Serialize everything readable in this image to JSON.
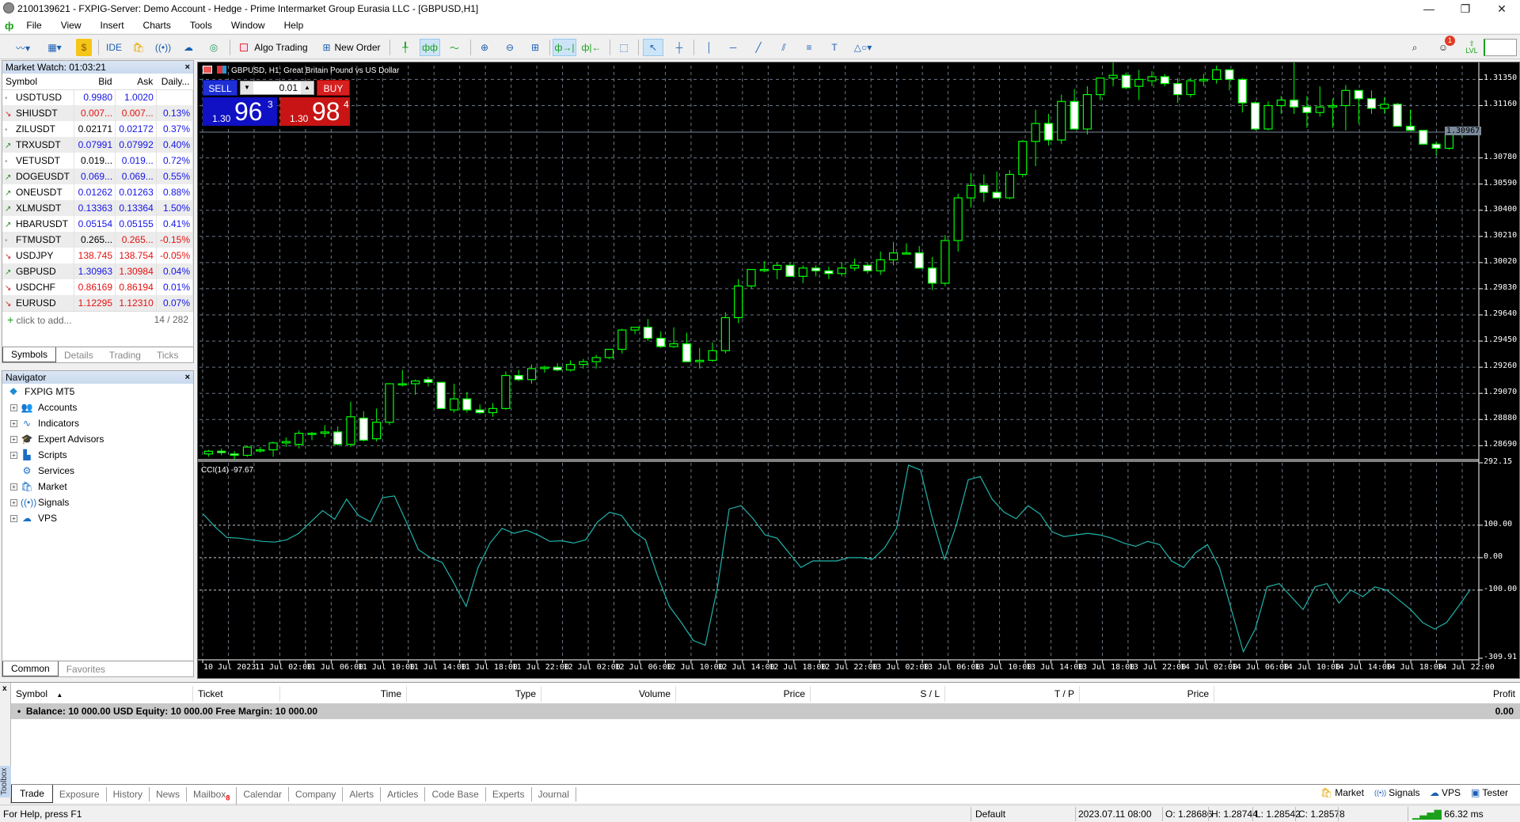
{
  "window": {
    "title": "2100139621 - FXPIG-Server: Demo Account - Hedge - Prime Intermarket Group Eurasia LLC - [GBPUSD,H1]"
  },
  "menu": [
    "File",
    "View",
    "Insert",
    "Charts",
    "Tools",
    "Window",
    "Help"
  ],
  "toolbar": {
    "ide_label": "IDE",
    "algo_trading_label": "Algo Trading",
    "new_order_label": "New Order",
    "notification_count": "1",
    "lvl_label": "LVL"
  },
  "market_watch": {
    "title": "Market Watch: 01:03:21",
    "columns": [
      "Symbol",
      "Bid",
      "Ask",
      "Daily..."
    ],
    "rows": [
      {
        "trend": "flat",
        "symbol": "USDTUSD",
        "bid": "0.9980",
        "bid_color": "blue",
        "ask": "1.0020",
        "ask_color": "blue",
        "daily": ""
      },
      {
        "trend": "down",
        "symbol": "SHIUSDT",
        "bid": "0.007...",
        "bid_color": "red",
        "ask": "0.007...",
        "ask_color": "red",
        "daily": "0.13%"
      },
      {
        "trend": "flat",
        "symbol": "ZILUSDT",
        "bid": "0.02171",
        "bid_color": "black",
        "ask": "0.02172",
        "ask_color": "blue",
        "daily": "0.37%"
      },
      {
        "trend": "up",
        "symbol": "TRXUSDT",
        "bid": "0.07991",
        "bid_color": "blue",
        "ask": "0.07992",
        "ask_color": "blue",
        "daily": "0.40%"
      },
      {
        "trend": "flat",
        "symbol": "VETUSDT",
        "bid": "0.019...",
        "bid_color": "black",
        "ask": "0.019...",
        "ask_color": "blue",
        "daily": "0.72%"
      },
      {
        "trend": "up",
        "symbol": "DOGEUSDT",
        "bid": "0.069...",
        "bid_color": "blue",
        "ask": "0.069...",
        "ask_color": "blue",
        "daily": "0.55%"
      },
      {
        "trend": "up",
        "symbol": "ONEUSDT",
        "bid": "0.01262",
        "bid_color": "blue",
        "ask": "0.01263",
        "ask_color": "blue",
        "daily": "0.88%"
      },
      {
        "trend": "up",
        "symbol": "XLMUSDT",
        "bid": "0.13363",
        "bid_color": "blue",
        "ask": "0.13364",
        "ask_color": "blue",
        "daily": "1.50%"
      },
      {
        "trend": "up",
        "symbol": "HBARUSDT",
        "bid": "0.05154",
        "bid_color": "blue",
        "ask": "0.05155",
        "ask_color": "blue",
        "daily": "0.41%"
      },
      {
        "trend": "flat",
        "symbol": "FTMUSDT",
        "bid": "0.265...",
        "bid_color": "black",
        "ask": "0.265...",
        "ask_color": "red",
        "daily": "-0.15%"
      },
      {
        "trend": "down",
        "symbol": "USDJPY",
        "bid": "138.745",
        "bid_color": "red",
        "ask": "138.754",
        "ask_color": "red",
        "daily": "-0.05%"
      },
      {
        "trend": "up",
        "symbol": "GBPUSD",
        "bid": "1.30963",
        "bid_color": "blue",
        "ask": "1.30984",
        "ask_color": "red",
        "daily": "0.04%"
      },
      {
        "trend": "down",
        "symbol": "USDCHF",
        "bid": "0.86169",
        "bid_color": "red",
        "ask": "0.86194",
        "ask_color": "red",
        "daily": "0.01%"
      },
      {
        "trend": "down",
        "symbol": "EURUSD",
        "bid": "1.12295",
        "bid_color": "red",
        "ask": "1.12310",
        "ask_color": "red",
        "daily": "0.07%"
      }
    ],
    "add_label": "click to add...",
    "count": "14 / 282",
    "tabs": [
      "Symbols",
      "Details",
      "Trading",
      "Ticks"
    ]
  },
  "navigator": {
    "title": "Navigator",
    "root": "FXPIG MT5",
    "items": [
      {
        "label": "Accounts",
        "icon": "accounts-icon",
        "glyph": "👥",
        "expand": true
      },
      {
        "label": "Indicators",
        "icon": "indicators-icon",
        "glyph": "∿",
        "expand": true
      },
      {
        "label": "Expert Advisors",
        "icon": "expert-advisors-icon",
        "glyph": "🎓",
        "expand": true
      },
      {
        "label": "Scripts",
        "icon": "scripts-icon",
        "glyph": "▙",
        "expand": true
      },
      {
        "label": "Services",
        "icon": "services-icon",
        "glyph": "⚙",
        "expand": false
      },
      {
        "label": "Market",
        "icon": "market-icon",
        "glyph": "🛍",
        "expand": true
      },
      {
        "label": "Signals",
        "icon": "signals-icon",
        "glyph": "((•))",
        "expand": true
      },
      {
        "label": "VPS",
        "icon": "vps-icon",
        "glyph": "☁",
        "expand": true
      }
    ],
    "tabs": [
      "Common",
      "Favorites"
    ]
  },
  "chart": {
    "label": "GBPUSD, H1:  Great Britain Pound vs US Dollar",
    "sell_label": "SELL",
    "buy_label": "BUY",
    "volume": "0.01",
    "sell_price": {
      "prefix": "1.30",
      "big": "96",
      "small": "3"
    },
    "buy_price": {
      "prefix": "1.30",
      "big": "98",
      "small": "4"
    },
    "current_price": "1.30967",
    "indicator_label": "CCI(14) -97.67"
  },
  "chart_data": [
    {
      "type": "candlestick",
      "title": "GBPUSD, H1",
      "ylim": [
        1.286,
        1.3145
      ],
      "y_ticks": [
        "1.31350",
        "1.31160",
        "1.30780",
        "1.30590",
        "1.30400",
        "1.30210",
        "1.30020",
        "1.29830",
        "1.29640",
        "1.29450",
        "1.29260",
        "1.29070",
        "1.28880",
        "1.28690"
      ],
      "y_tick_values": [
        1.3135,
        1.3116,
        1.3078,
        1.3059,
        1.304,
        1.3021,
        1.3002,
        1.2983,
        1.2964,
        1.2945,
        1.2926,
        1.2907,
        1.2888,
        1.2869
      ],
      "x_ticks": [
        "10 Jul 2023",
        "11 Jul 02:00",
        "11 Jul 06:00",
        "11 Jul 10:00",
        "11 Jul 14:00",
        "11 Jul 18:00",
        "11 Jul 22:00",
        "12 Jul 02:00",
        "12 Jul 06:00",
        "12 Jul 10:00",
        "12 Jul 14:00",
        "12 Jul 18:00",
        "12 Jul 22:00",
        "13 Jul 02:00",
        "13 Jul 06:00",
        "13 Jul 10:00",
        "13 Jul 14:00",
        "13 Jul 18:00",
        "13 Jul 22:00",
        "14 Jul 02:00",
        "14 Jul 06:00",
        "14 Jul 10:00",
        "14 Jul 14:00",
        "14 Jul 18:00",
        "14 Jul 22:00"
      ],
      "current_price": 1.30967,
      "ohlc": [
        [
          1.2863,
          1.2866,
          1.2861,
          1.2865
        ],
        [
          1.2865,
          1.2867,
          1.2862,
          1.2864
        ],
        [
          1.2863,
          1.2865,
          1.2859,
          1.2862
        ],
        [
          1.2862,
          1.2869,
          1.2861,
          1.2868
        ],
        [
          1.2866,
          1.2868,
          1.2864,
          1.2866
        ],
        [
          1.2866,
          1.2872,
          1.2861,
          1.2871
        ],
        [
          1.2871,
          1.2875,
          1.2868,
          1.2872
        ],
        [
          1.287,
          1.288,
          1.2867,
          1.2878
        ],
        [
          1.2878,
          1.2879,
          1.2873,
          1.2878
        ],
        [
          1.2878,
          1.2884,
          1.2875,
          1.2879
        ],
        [
          1.2879,
          1.2883,
          1.2869,
          1.287
        ],
        [
          1.287,
          1.2901,
          1.2868,
          1.289
        ],
        [
          1.2889,
          1.2894,
          1.2872,
          1.2873
        ],
        [
          1.2874,
          1.2896,
          1.2872,
          1.2886
        ],
        [
          1.2886,
          1.2914,
          1.2884,
          1.2914
        ],
        [
          1.2914,
          1.2924,
          1.2912,
          1.2914
        ],
        [
          1.2914,
          1.2917,
          1.2906,
          1.2916
        ],
        [
          1.2917,
          1.2919,
          1.2912,
          1.2915
        ],
        [
          1.2915,
          1.2915,
          1.2899,
          1.2896
        ],
        [
          1.2895,
          1.2914,
          1.2893,
          1.2903
        ],
        [
          1.2903,
          1.2908,
          1.2893,
          1.2895
        ],
        [
          1.2895,
          1.2899,
          1.2892,
          1.2893
        ],
        [
          1.2893,
          1.29,
          1.289,
          1.2896
        ],
        [
          1.2896,
          1.2923,
          1.2895,
          1.292
        ],
        [
          1.292,
          1.2924,
          1.2916,
          1.2917
        ],
        [
          1.2917,
          1.2928,
          1.2914,
          1.2925
        ],
        [
          1.2925,
          1.2927,
          1.2922,
          1.2926
        ],
        [
          1.2926,
          1.2929,
          1.2923,
          1.2924
        ],
        [
          1.2924,
          1.2931,
          1.2923,
          1.2928
        ],
        [
          1.2928,
          1.2932,
          1.2925,
          1.293
        ],
        [
          1.293,
          1.2935,
          1.2925,
          1.2933
        ],
        [
          1.2933,
          1.2939,
          1.2932,
          1.2939
        ],
        [
          1.2939,
          1.2954,
          1.2936,
          1.2953
        ],
        [
          1.2953,
          1.2955,
          1.295,
          1.2955
        ],
        [
          1.2955,
          1.2961,
          1.2945,
          1.2947
        ],
        [
          1.2947,
          1.2952,
          1.294,
          1.2941
        ],
        [
          1.2941,
          1.2955,
          1.294,
          1.2943
        ],
        [
          1.2943,
          1.2951,
          1.2937,
          1.293
        ],
        [
          1.293,
          1.294,
          1.2925,
          1.2931
        ],
        [
          1.2931,
          1.2944,
          1.293,
          1.2938
        ],
        [
          1.2938,
          1.2966,
          1.2936,
          1.2962
        ],
        [
          1.2962,
          1.299,
          1.2958,
          1.2985
        ],
        [
          1.2985,
          1.2997,
          1.2983,
          1.2997
        ],
        [
          1.2997,
          1.3003,
          1.2995,
          1.2997
        ],
        [
          1.2997,
          1.3002,
          1.299,
          1.3
        ],
        [
          1.3,
          1.3002,
          1.2995,
          1.2992
        ],
        [
          1.2992,
          1.3,
          1.2987,
          1.2998
        ],
        [
          1.2998,
          1.3,
          1.2992,
          1.2996
        ],
        [
          1.2996,
          1.2999,
          1.299,
          1.2994
        ],
        [
          1.2994,
          1.3002,
          1.2992,
          1.2998
        ],
        [
          1.2998,
          1.3005,
          1.2996,
          1.3
        ],
        [
          1.3,
          1.3002,
          1.2994,
          1.2996
        ],
        [
          1.2996,
          1.301,
          1.2993,
          1.3004
        ],
        [
          1.3004,
          1.3017,
          1.3,
          1.3009
        ],
        [
          1.3009,
          1.3016,
          1.3008,
          1.3009
        ],
        [
          1.3009,
          1.3014,
          1.2999,
          1.2998
        ],
        [
          1.2998,
          1.3006,
          1.2982,
          1.2987
        ],
        [
          1.2987,
          1.3022,
          1.2985,
          1.3018
        ],
        [
          1.3018,
          1.3052,
          1.301,
          1.3049
        ],
        [
          1.3049,
          1.3067,
          1.3042,
          1.3058
        ],
        [
          1.3058,
          1.3066,
          1.3046,
          1.3053
        ],
        [
          1.3053,
          1.3068,
          1.305,
          1.3049
        ],
        [
          1.3049,
          1.3069,
          1.3048,
          1.3066
        ],
        [
          1.3066,
          1.3091,
          1.3064,
          1.309
        ],
        [
          1.309,
          1.3113,
          1.3072,
          1.3103
        ],
        [
          1.3103,
          1.311,
          1.3087,
          1.3091
        ],
        [
          1.3091,
          1.3124,
          1.3088,
          1.3119
        ],
        [
          1.3119,
          1.3128,
          1.3107,
          1.3099
        ],
        [
          1.3099,
          1.313,
          1.3095,
          1.3124
        ],
        [
          1.3124,
          1.3135,
          1.312,
          1.3136
        ],
        [
          1.3136,
          1.3148,
          1.313,
          1.3138
        ],
        [
          1.3138,
          1.314,
          1.3128,
          1.3129
        ],
        [
          1.313,
          1.3142,
          1.312,
          1.3135
        ],
        [
          1.3134,
          1.3141,
          1.313,
          1.3137
        ],
        [
          1.3137,
          1.3139,
          1.313,
          1.3132
        ],
        [
          1.3132,
          1.3136,
          1.3118,
          1.3124
        ],
        [
          1.3124,
          1.3136,
          1.3122,
          1.3134
        ],
        [
          1.3134,
          1.3139,
          1.313,
          1.3135
        ],
        [
          1.3135,
          1.3145,
          1.3132,
          1.3142
        ],
        [
          1.3142,
          1.3142,
          1.3127,
          1.3135
        ],
        [
          1.3135,
          1.3136,
          1.3111,
          1.3118
        ],
        [
          1.3118,
          1.3119,
          1.3098,
          1.3099
        ],
        [
          1.3099,
          1.3119,
          1.3098,
          1.3116
        ],
        [
          1.3116,
          1.3123,
          1.311,
          1.312
        ],
        [
          1.312,
          1.3148,
          1.311,
          1.3115
        ],
        [
          1.3115,
          1.3123,
          1.31,
          1.3111
        ],
        [
          1.3111,
          1.313,
          1.3108,
          1.3115
        ],
        [
          1.3115,
          1.3121,
          1.31,
          1.3116
        ],
        [
          1.3116,
          1.3131,
          1.3098,
          1.3127
        ],
        [
          1.3127,
          1.3124,
          1.3103,
          1.3121
        ],
        [
          1.3121,
          1.3127,
          1.311,
          1.3114
        ],
        [
          1.3114,
          1.3122,
          1.311,
          1.3117
        ],
        [
          1.3117,
          1.3118,
          1.3102,
          1.3101
        ],
        [
          1.3101,
          1.3113,
          1.3099,
          1.3098
        ],
        [
          1.3098,
          1.3097,
          1.309,
          1.3088
        ],
        [
          1.3088,
          1.309,
          1.308,
          1.3085
        ],
        [
          1.3085,
          1.3095,
          1.3084,
          1.3095
        ],
        [
          1.3095,
          1.3099,
          1.3093,
          1.3097
        ]
      ]
    },
    {
      "type": "line",
      "title": "CCI(14) -97.67",
      "ylim": [
        -309.91,
        292.15
      ],
      "y_ticks": [
        "292.15",
        "100.00",
        "0.00",
        "-100.00",
        "-309.91"
      ],
      "y_tick_values": [
        292.15,
        100,
        0,
        -100,
        -309.91
      ],
      "levels": [
        100,
        0,
        -100
      ],
      "values": [
        135,
        95,
        62,
        60,
        55,
        50,
        48,
        55,
        75,
        110,
        145,
        118,
        180,
        130,
        110,
        185,
        190,
        110,
        25,
        0,
        -15,
        -80,
        -150,
        -30,
        45,
        90,
        75,
        85,
        70,
        50,
        52,
        45,
        55,
        110,
        140,
        130,
        80,
        55,
        -55,
        -150,
        -200,
        -255,
        -270,
        -95,
        150,
        160,
        120,
        70,
        60,
        15,
        -30,
        -10,
        -10,
        -10,
        0,
        0,
        -5,
        30,
        90,
        285,
        270,
        120,
        -5,
        100,
        240,
        250,
        180,
        140,
        120,
        160,
        135,
        80,
        65,
        70,
        75,
        70,
        60,
        45,
        35,
        50,
        40,
        -10,
        -30,
        15,
        40,
        -30,
        -160,
        -290,
        -220,
        -90,
        -80,
        -120,
        -160,
        -90,
        -80,
        -140,
        -100,
        -120,
        -90,
        -100,
        -130,
        -160,
        -200,
        -220,
        -200,
        -150,
        -97.67
      ]
    }
  ],
  "toolbox": {
    "columns": [
      "Symbol",
      "Ticket",
      "Time",
      "Type",
      "Volume",
      "Price",
      "S / L",
      "T / P",
      "Price",
      "Profit"
    ],
    "balance_row": "Balance: 10 000.00 USD  Equity: 10 000.00  Free Margin: 10 000.00",
    "profit": "0.00",
    "side_label": "Toolbox",
    "tabs": [
      "Trade",
      "Exposure",
      "History",
      "News",
      "Mailbox",
      "Calendar",
      "Company",
      "Alerts",
      "Articles",
      "Code Base",
      "Experts",
      "Journal"
    ],
    "mailbox_badge": "8",
    "right_links": [
      "Market",
      "Signals",
      "VPS",
      "Tester"
    ]
  },
  "statusbar": {
    "help": "For Help, press F1",
    "profile": "Default",
    "datetime": "2023.07.11 08:00",
    "open": "O: 1.28686",
    "high": "H: 1.28744",
    "low": "L: 1.28542",
    "close": "C: 1.28578",
    "ping": "66.32 ms"
  }
}
